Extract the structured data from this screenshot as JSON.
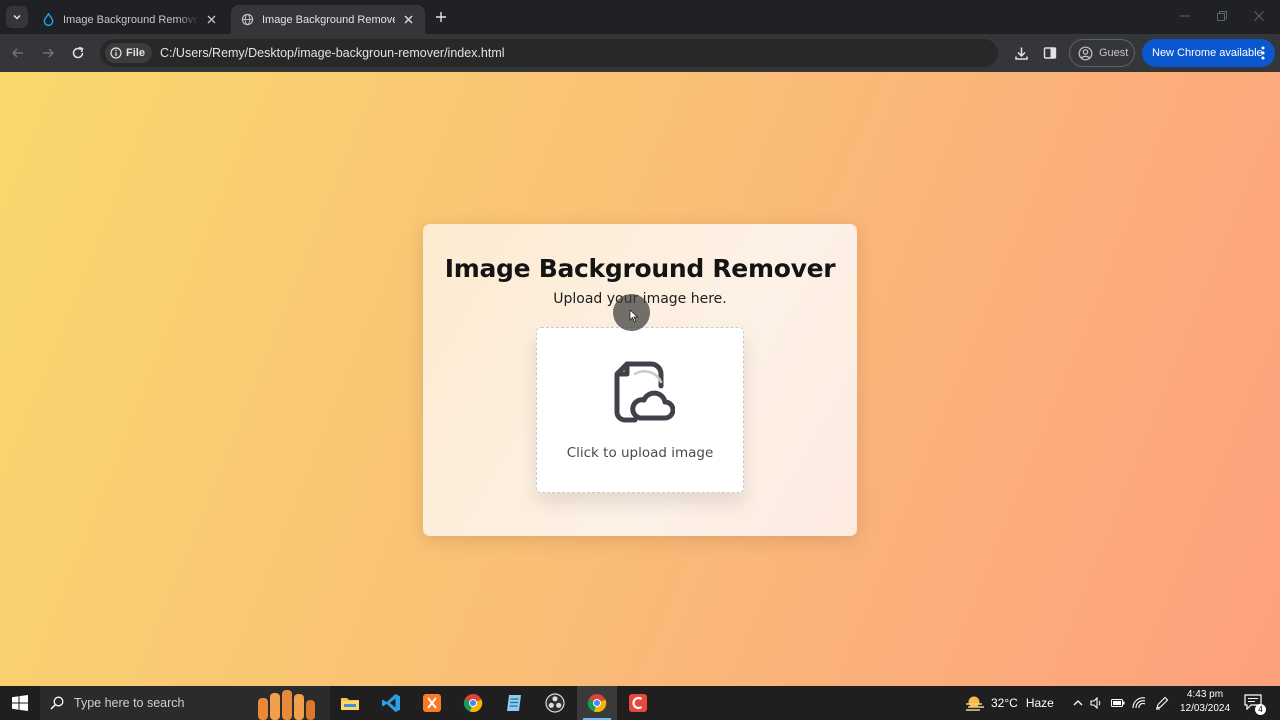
{
  "browser": {
    "tabs": [
      {
        "title": "Image Background Remover UI",
        "favicon": "drop-icon",
        "active": false
      },
      {
        "title": "Image Background Remover",
        "favicon": "globe-icon",
        "active": true
      }
    ],
    "address_chip": "File",
    "url": "C:/Users/Remy/Desktop/image-backgroun-remover/index.html",
    "profile_label": "Guest",
    "update_label": "New Chrome available",
    "colors": {
      "accent": "#0b57d0",
      "toolbar": "#35363a",
      "tabstrip": "#202124"
    }
  },
  "page": {
    "title": "Image Background Remover",
    "subtitle": "Upload your image here.",
    "dropzone_label": "Click to upload image",
    "upload_icon": "file-cloud-upload-icon",
    "background_gradient": [
      "#f9d96c",
      "#fca07e"
    ]
  },
  "taskbar": {
    "search_placeholder": "Type here to search",
    "apps": [
      "file-explorer-icon",
      "vscode-icon",
      "xampp-icon",
      "chrome-alt-icon",
      "notepad-icon",
      "obs-icon",
      "chrome-icon",
      "screen-recorder-icon"
    ],
    "weather": {
      "temp": "32°C",
      "condition": "Haze"
    },
    "clock": {
      "time": "4:43 pm",
      "date": "12/03/2024"
    },
    "notification_count": "4"
  }
}
